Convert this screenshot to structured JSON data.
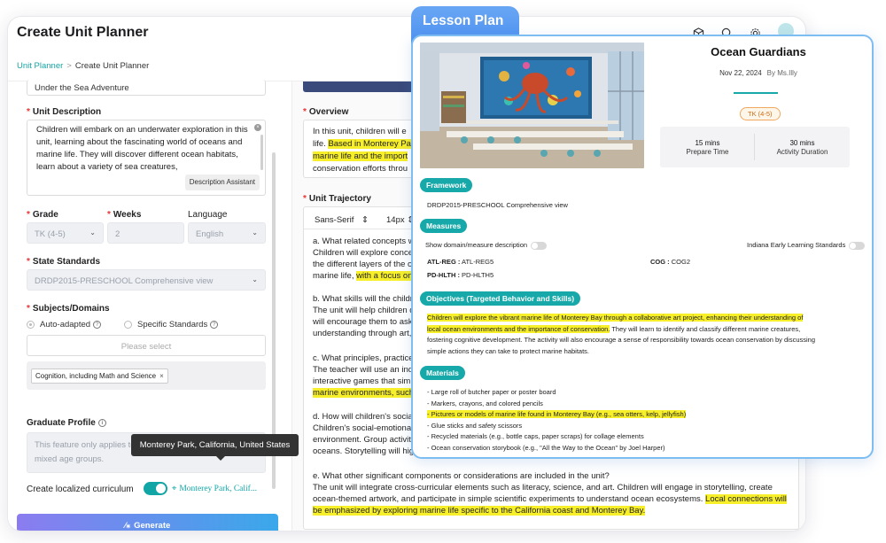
{
  "header": {
    "title": "Create Unit Planner",
    "breadcrumb_link": "Unit Planner",
    "breadcrumb_sep": ">",
    "breadcrumb_current": "Create Unit Planner"
  },
  "form": {
    "unit_name_value": "Under the Sea Adventure",
    "description_label": "Unit Description",
    "description_value": "Children will embark on an underwater exploration in this unit, learning about the fascinating world of oceans and marine life. They will discover different ocean habitats, learn about a variety of sea creatures,",
    "description_assistant": "Description Assistant",
    "grade_label": "Grade",
    "grade_value": "TK (4-5)",
    "weeks_label": "Weeks",
    "weeks_value": "2",
    "language_label": "Language",
    "language_value": "English",
    "standards_label": "State Standards",
    "standards_value": "DRDP2015-PRESCHOOL Comprehensive view",
    "subjects_label": "Subjects/Domains",
    "auto_adapted": "Auto-adapted",
    "specific_standards": "Specific Standards",
    "please_select": "Please select",
    "subject_tag": "Cognition, including Math and Science",
    "graduate_label": "Graduate Profile",
    "graduate_placeholder": "This feature only applies to K through Grade 12, including mixed age groups.",
    "localized_label": "Create localized curriculum",
    "location_value": "Monterey Park, Calif...",
    "tooltip": "Monterey Park, California, United States",
    "generate": "Generate"
  },
  "content": {
    "overview_label": "Overview",
    "overview_l1": "In this unit, children will e",
    "overview_l2a": "life. ",
    "overview_l2b": "Based in Monterey Pa",
    "overview_l3": "marine life and the import",
    "overview_l4": "conservation efforts throu",
    "trajectory_label": "Unit Trajectory",
    "font": "Sans-Serif",
    "size": "14px",
    "a_q": "a. What related concepts wil",
    "a_1": "Children will explore concep",
    "a_2": "the different layers of the oc",
    "a_3a": "marine life, ",
    "a_3b": "with a focus on",
    "b_q": "b. What skills will the childre",
    "b_1": "The unit will help children d",
    "b_2": "will encourage them to ask",
    "b_3": "understanding through art, s",
    "c_q": "c. What principles, practices",
    "c_1": "The teacher will use an inqu",
    "c_2": "interactive games that simu",
    "c_3": "marine environments, such",
    "d_q": "d. How will children's social-",
    "d_1": "Children's social-emotional",
    "d_2": "environment. Group activitie",
    "d_3": "oceans. Storytelling will high",
    "e_q": "e. What other significant components or considerations are included in the unit?",
    "e_1": "The unit will integrate cross-curricular elements such as literacy, science, and art. Children will engage in storytelling, create",
    "e_2a": "ocean-themed artwork, and participate in simple scientific experiments to understand ocean ecosystems. ",
    "e_2b": "Local connections will",
    "e_3": "be emphasized by exploring marine life specific to the California coast and Monterey Bay."
  },
  "lesson": {
    "tab": "Lesson Plan",
    "title": "Ocean Guardians",
    "date": "Nov 22, 2024",
    "by": "By Ms.Illy",
    "badge": "TK (4-5)",
    "prep_time": "15 mins",
    "prep_label": "Prepare Time",
    "act_time": "30 mins",
    "act_label": "Activity Duration",
    "framework_pill": "Framework",
    "framework_value": "DRDP2015-PRESCHOOL Comprehensive view",
    "measures_pill": "Measures",
    "show_desc": "Show domain/measure description",
    "indiana": "Indiana Early Learning Standards",
    "m1_key": "ATL-REG :",
    "m1_val": " ATL-REG5",
    "m2_key": "COG :",
    "m2_val": " COG2",
    "m3_key": "PD-HLTH :",
    "m3_val": " PD-HLTH5",
    "objectives_pill": "Objectives (Targeted Behavior and Skills)",
    "obj_hl1": "Children will explore the vibrant marine life of Monterey Bay through a collaborative art project, enhancing their understanding of",
    "obj_hl2": "local ocean environments and the importance of conservation.",
    "obj_2b": " They will learn to identify and classify different marine creatures,",
    "obj_3": "fostering cognitive development. The activity will also encourage a sense of responsibility towards ocean conservation by discussing",
    "obj_4": "simple actions they can take to protect marine habitats.",
    "materials_pill": "Materials",
    "materials": [
      "- Large roll of butcher paper or poster board",
      "- Markers, crayons, and colored pencils",
      "- Pictures or models of marine life found in Monterey Bay (e.g., sea otters, kelp, jellyfish)",
      "- Glue sticks and safety scissors",
      "- Recycled materials (e.g., bottle caps, paper scraps) for collage elements",
      "- Ocean conservation storybook (e.g., \"All the Way to the Ocean\" by Joel Harper)"
    ]
  }
}
